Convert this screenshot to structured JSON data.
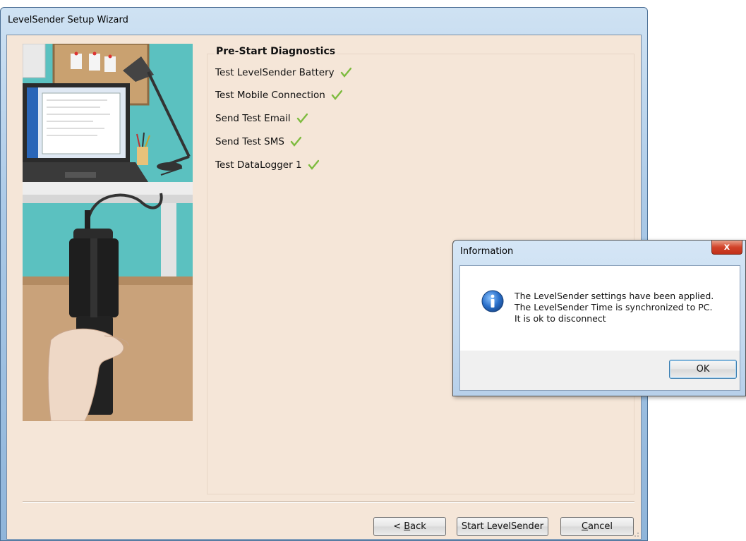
{
  "wizard": {
    "title": "LevelSender Setup Wizard",
    "panel_title": "Pre-Start Diagnostics",
    "diagnostics": [
      {
        "label": "Test LevelSender Battery",
        "status": "passed"
      },
      {
        "label": "Test Mobile Connection",
        "status": "passed"
      },
      {
        "label": "Send Test Email",
        "status": "passed"
      },
      {
        "label": "Send Test SMS",
        "status": "passed"
      },
      {
        "label": "Test DataLogger 1",
        "status": "passed"
      }
    ],
    "buttons": {
      "back_prefix": "< ",
      "back_accel": "B",
      "back_rest": "ack",
      "start": "Start LevelSender",
      "cancel_accel": "C",
      "cancel_rest": "ancel"
    }
  },
  "dialog": {
    "title": "Information",
    "close_glyph": "x",
    "lines": [
      "The LevelSender settings have been applied.",
      "The LevelSender Time is synchronized to PC.",
      "It is ok to disconnect"
    ],
    "ok_label": "OK"
  },
  "colors": {
    "check": "#7dbb3e",
    "window_bg": "#f5e6d8",
    "info_icon": "#2a6fc9"
  }
}
